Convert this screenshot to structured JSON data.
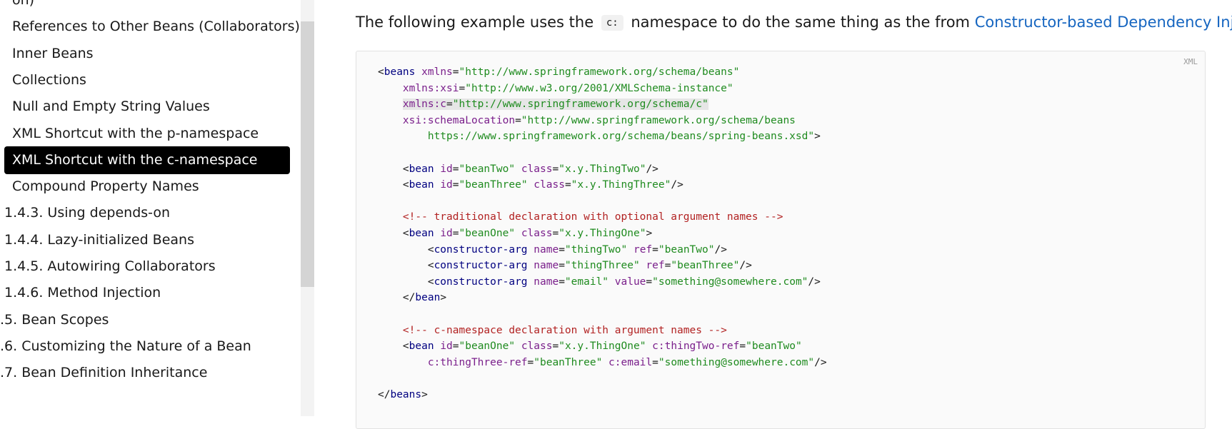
{
  "sidebar": {
    "items": [
      {
        "label": "on)",
        "level": "l2",
        "active": false
      },
      {
        "label": "References to Other Beans (Collaborators)",
        "level": "l2",
        "active": false
      },
      {
        "label": "Inner Beans",
        "level": "l2",
        "active": false
      },
      {
        "label": "Collections",
        "level": "l2",
        "active": false
      },
      {
        "label": "Null and Empty String Values",
        "level": "l2",
        "active": false
      },
      {
        "label": "XML Shortcut with the p-namespace",
        "level": "l2",
        "active": false
      },
      {
        "label": "XML Shortcut with the c-namespace",
        "level": "l2",
        "active": true
      },
      {
        "label": "Compound Property Names",
        "level": "l2",
        "active": false
      },
      {
        "label": "1.4.3. Using depends-on",
        "level": "l1",
        "active": false
      },
      {
        "label": "1.4.4. Lazy-initialized Beans",
        "level": "l1",
        "active": false
      },
      {
        "label": "1.4.5. Autowiring Collaborators",
        "level": "l1",
        "active": false
      },
      {
        "label": "1.4.6. Method Injection",
        "level": "l1",
        "active": false
      },
      {
        "label": ".5. Bean Scopes",
        "level": "l0",
        "active": false
      },
      {
        "label": ".6. Customizing the Nature of a Bean",
        "level": "l0",
        "active": false
      },
      {
        "label": ".7. Bean Definition Inheritance",
        "level": "l0",
        "active": false
      }
    ]
  },
  "main": {
    "intro": {
      "before": "The following example uses the",
      "code": "c:",
      "middle": "namespace to do the same thing as the from",
      "link": "Constructor-based Dependency Injection",
      "after": ":"
    },
    "code_block": {
      "language": "XML",
      "lines": [
        [
          [
            "t-pun",
            "<"
          ],
          [
            "t-tag",
            "beans"
          ],
          [
            "t-pun",
            " "
          ],
          [
            "t-attr",
            "xmlns"
          ],
          [
            "t-pun",
            "="
          ],
          [
            "t-val",
            "\"http://www.springframework.org/schema/beans\""
          ]
        ],
        [
          [
            "t-pun",
            "    "
          ],
          [
            "t-attr",
            "xmlns:xsi"
          ],
          [
            "t-pun",
            "="
          ],
          [
            "t-val",
            "\"http://www.w3.org/2001/XMLSchema-instance\""
          ]
        ],
        [
          [
            "t-pun",
            "    "
          ],
          [
            "hl:t-attr",
            "xmlns:c"
          ],
          [
            "hl:t-pun",
            "="
          ],
          [
            "hl:t-val",
            "\"http://www.springframework.org/schema/c\""
          ]
        ],
        [
          [
            "t-pun",
            "    "
          ],
          [
            "t-attr",
            "xsi:schemaLocation"
          ],
          [
            "t-pun",
            "="
          ],
          [
            "t-val",
            "\"http://www.springframework.org/schema/beans"
          ]
        ],
        [
          [
            "t-pun",
            "        "
          ],
          [
            "t-val",
            "https://www.springframework.org/schema/beans/spring-beans.xsd\""
          ],
          [
            "t-pun",
            ">"
          ]
        ],
        [],
        [
          [
            "t-pun",
            "    <"
          ],
          [
            "t-tag",
            "bean"
          ],
          [
            "t-pun",
            " "
          ],
          [
            "t-attr",
            "id"
          ],
          [
            "t-pun",
            "="
          ],
          [
            "t-val",
            "\"beanTwo\""
          ],
          [
            "t-pun",
            " "
          ],
          [
            "t-attr",
            "class"
          ],
          [
            "t-pun",
            "="
          ],
          [
            "t-val",
            "\"x.y.ThingTwo\""
          ],
          [
            "t-pun",
            "/>"
          ]
        ],
        [
          [
            "t-pun",
            "    <"
          ],
          [
            "t-tag",
            "bean"
          ],
          [
            "t-pun",
            " "
          ],
          [
            "t-attr",
            "id"
          ],
          [
            "t-pun",
            "="
          ],
          [
            "t-val",
            "\"beanThree\""
          ],
          [
            "t-pun",
            " "
          ],
          [
            "t-attr",
            "class"
          ],
          [
            "t-pun",
            "="
          ],
          [
            "t-val",
            "\"x.y.ThingThree\""
          ],
          [
            "t-pun",
            "/>"
          ]
        ],
        [],
        [
          [
            "t-pun",
            "    "
          ],
          [
            "t-com",
            "<!-- traditional declaration with optional argument names -->"
          ]
        ],
        [
          [
            "t-pun",
            "    <"
          ],
          [
            "t-tag",
            "bean"
          ],
          [
            "t-pun",
            " "
          ],
          [
            "t-attr",
            "id"
          ],
          [
            "t-pun",
            "="
          ],
          [
            "t-val",
            "\"beanOne\""
          ],
          [
            "t-pun",
            " "
          ],
          [
            "t-attr",
            "class"
          ],
          [
            "t-pun",
            "="
          ],
          [
            "t-val",
            "\"x.y.ThingOne\""
          ],
          [
            "t-pun",
            ">"
          ]
        ],
        [
          [
            "t-pun",
            "        <"
          ],
          [
            "t-tag",
            "constructor-arg"
          ],
          [
            "t-pun",
            " "
          ],
          [
            "t-attr",
            "name"
          ],
          [
            "t-pun",
            "="
          ],
          [
            "t-val",
            "\"thingTwo\""
          ],
          [
            "t-pun",
            " "
          ],
          [
            "t-attr",
            "ref"
          ],
          [
            "t-pun",
            "="
          ],
          [
            "t-val",
            "\"beanTwo\""
          ],
          [
            "t-pun",
            "/>"
          ]
        ],
        [
          [
            "t-pun",
            "        <"
          ],
          [
            "t-tag",
            "constructor-arg"
          ],
          [
            "t-pun",
            " "
          ],
          [
            "t-attr",
            "name"
          ],
          [
            "t-pun",
            "="
          ],
          [
            "t-val",
            "\"thingThree\""
          ],
          [
            "t-pun",
            " "
          ],
          [
            "t-attr",
            "ref"
          ],
          [
            "t-pun",
            "="
          ],
          [
            "t-val",
            "\"beanThree\""
          ],
          [
            "t-pun",
            "/>"
          ]
        ],
        [
          [
            "t-pun",
            "        <"
          ],
          [
            "t-tag",
            "constructor-arg"
          ],
          [
            "t-pun",
            " "
          ],
          [
            "t-attr",
            "name"
          ],
          [
            "t-pun",
            "="
          ],
          [
            "t-val",
            "\"email\""
          ],
          [
            "t-pun",
            " "
          ],
          [
            "t-attr",
            "value"
          ],
          [
            "t-pun",
            "="
          ],
          [
            "t-val",
            "\"something@somewhere.com\""
          ],
          [
            "t-pun",
            "/>"
          ]
        ],
        [
          [
            "t-pun",
            "    </"
          ],
          [
            "t-tag",
            "bean"
          ],
          [
            "t-pun",
            ">"
          ]
        ],
        [],
        [
          [
            "t-pun",
            "    "
          ],
          [
            "t-com",
            "<!-- c-namespace declaration with argument names -->"
          ]
        ],
        [
          [
            "t-pun",
            "    <"
          ],
          [
            "t-tag",
            "bean"
          ],
          [
            "t-pun",
            " "
          ],
          [
            "t-attr",
            "id"
          ],
          [
            "t-pun",
            "="
          ],
          [
            "t-val",
            "\"beanOne\""
          ],
          [
            "t-pun",
            " "
          ],
          [
            "t-attr",
            "class"
          ],
          [
            "t-pun",
            "="
          ],
          [
            "t-val",
            "\"x.y.ThingOne\""
          ],
          [
            "t-pun",
            " "
          ],
          [
            "t-attr",
            "c:thingTwo-ref"
          ],
          [
            "t-pun",
            "="
          ],
          [
            "t-val",
            "\"beanTwo\""
          ]
        ],
        [
          [
            "t-pun",
            "        "
          ],
          [
            "t-attr",
            "c:thingThree-ref"
          ],
          [
            "t-pun",
            "="
          ],
          [
            "t-val",
            "\"beanThree\""
          ],
          [
            "t-pun",
            " "
          ],
          [
            "t-attr",
            "c:email"
          ],
          [
            "t-pun",
            "="
          ],
          [
            "t-val",
            "\"something@somewhere.com\""
          ],
          [
            "t-pun",
            "/>"
          ]
        ],
        [],
        [
          [
            "t-pun",
            "</"
          ],
          [
            "t-tag",
            "beans"
          ],
          [
            "t-pun",
            ">"
          ]
        ]
      ]
    }
  }
}
